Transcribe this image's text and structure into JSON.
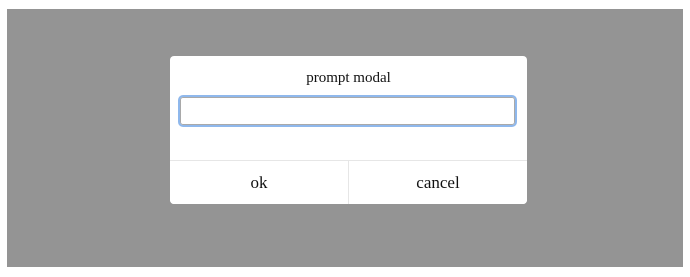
{
  "modal": {
    "title": "prompt modal",
    "input": {
      "value": "",
      "placeholder": ""
    },
    "ok_label": "ok",
    "cancel_label": "cancel"
  },
  "colors": {
    "backdrop": "#949494",
    "modal_background": "#ffffff",
    "input_focus_ring": "#8fb8ec"
  }
}
